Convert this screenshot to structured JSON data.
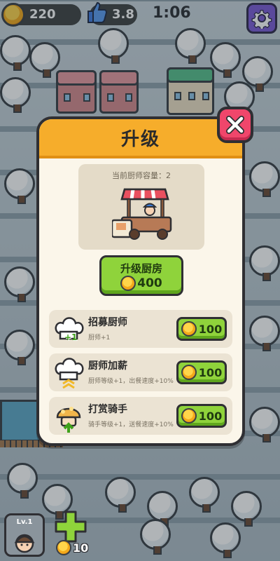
{
  "hud": {
    "coins": "220",
    "rating": "3.8",
    "timer": "1:06",
    "icons": {
      "coin": "coin-icon",
      "rating": "thumbs-up-icon",
      "settings": "gear-icon"
    }
  },
  "dialog": {
    "title": "升级",
    "kitchen_capacity": "当前厨师容量：2",
    "upgrade": {
      "label": "升级厨房",
      "cost": "400"
    },
    "items": [
      {
        "title": "招募厨师",
        "desc": "厨师+1",
        "cost": "100",
        "badge": "+1",
        "icon": "chef-hat-icon"
      },
      {
        "title": "厨师加薪",
        "desc": "厨师等级+1，出餐速度+10%",
        "cost": "100",
        "icon": "chef-hat-icon"
      },
      {
        "title": "打赏骑手",
        "desc": "骑手等级+1，送餐速度+10%",
        "cost": "100",
        "icon": "rider-icon"
      }
    ]
  },
  "bottom": {
    "level": "Lv.1",
    "add_cost": "10"
  },
  "colors": {
    "header": "#f6ad2b",
    "buy_button": "#8fd33b",
    "close_button": "#f0466b",
    "settings_button": "#7b5bd6"
  }
}
